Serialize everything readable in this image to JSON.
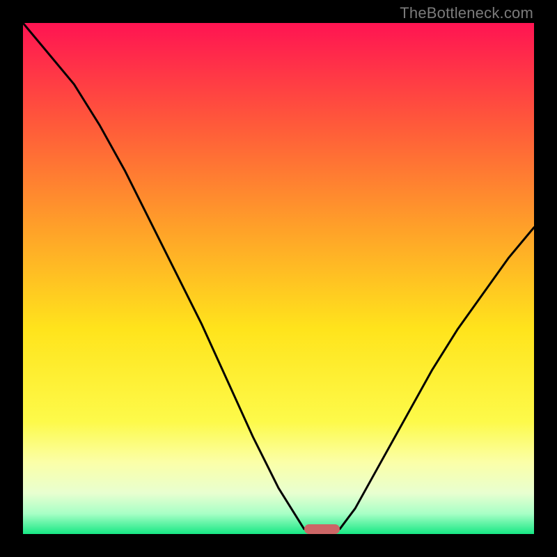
{
  "watermark": "TheBottleneck.com",
  "chart_data": {
    "type": "line",
    "title": "",
    "xlabel": "",
    "ylabel": "",
    "xlim": [
      0,
      100
    ],
    "ylim": [
      0,
      100
    ],
    "grid": false,
    "series": [
      {
        "name": "bottleneck-curve",
        "x": [
          0,
          5,
          10,
          15,
          20,
          25,
          30,
          35,
          40,
          45,
          50,
          55,
          57,
          60,
          62,
          65,
          70,
          75,
          80,
          85,
          90,
          95,
          100
        ],
        "y": [
          100,
          94,
          88,
          80,
          71,
          61,
          51,
          41,
          30,
          19,
          9,
          1,
          0,
          0,
          1,
          5,
          14,
          23,
          32,
          40,
          47,
          54,
          60
        ]
      }
    ],
    "annotations": [
      {
        "name": "optimum-marker",
        "x_range": [
          55,
          62
        ],
        "y": 0
      }
    ],
    "gradient_stops": [
      {
        "offset": 0.0,
        "color": "#ff1452"
      },
      {
        "offset": 0.2,
        "color": "#ff5a3a"
      },
      {
        "offset": 0.4,
        "color": "#ffa029"
      },
      {
        "offset": 0.6,
        "color": "#ffe41c"
      },
      {
        "offset": 0.78,
        "color": "#fdfa4a"
      },
      {
        "offset": 0.86,
        "color": "#fbffa8"
      },
      {
        "offset": 0.92,
        "color": "#e8ffd0"
      },
      {
        "offset": 0.96,
        "color": "#a8ffc6"
      },
      {
        "offset": 1.0,
        "color": "#17e884"
      }
    ],
    "curve_color": "#000000",
    "marker_color": "#cc6666"
  }
}
